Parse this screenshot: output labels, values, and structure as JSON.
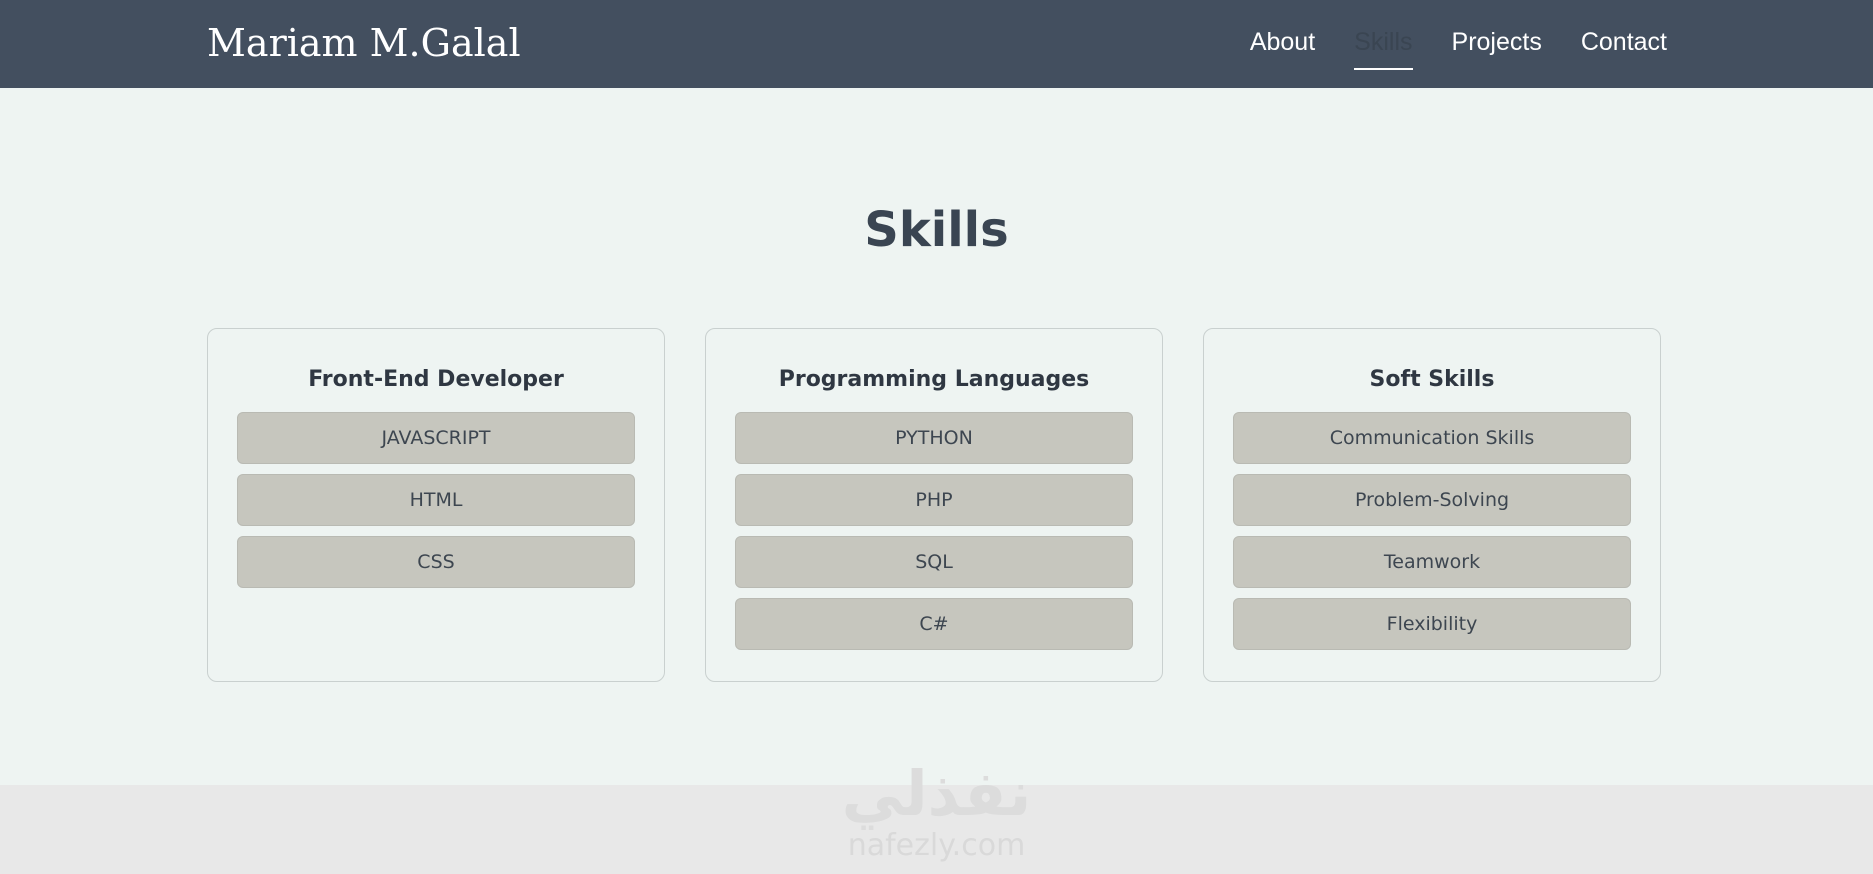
{
  "header": {
    "brand": "Mariam M.Galal",
    "nav": [
      {
        "label": "About",
        "active": false
      },
      {
        "label": "Skills",
        "active": true
      },
      {
        "label": "Projects",
        "active": false
      },
      {
        "label": "Contact",
        "active": false
      }
    ]
  },
  "main": {
    "title": "Skills",
    "cards": [
      {
        "title": "Front-End Developer",
        "skills": [
          "JAVASCRIPT",
          "HTML",
          "CSS"
        ]
      },
      {
        "title": "Programming Languages",
        "skills": [
          "PYTHON",
          "PHP",
          "SQL",
          "C#"
        ]
      },
      {
        "title": "Soft Skills",
        "skills": [
          "Communication Skills",
          "Problem-Solving",
          "Teamwork",
          "Flexibility"
        ]
      }
    ]
  },
  "watermark": {
    "arabic": "نفذلي",
    "latin": "nafezly.com"
  },
  "colors": {
    "navbar": "#434f5f",
    "page_background": "#eef4f2",
    "skill_pill": "#c6c6be",
    "title_text": "#3a4552"
  }
}
